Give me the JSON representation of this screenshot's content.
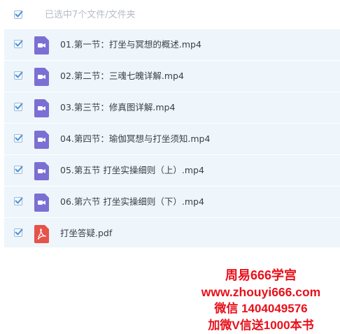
{
  "header": {
    "selection_text": "已选中7个文件/文件夹"
  },
  "files": [
    {
      "name": "01.第一节：打坐与冥想的概述.mp4",
      "type": "video-icon",
      "checked": true
    },
    {
      "name": "02.第二节：三魂七魄详解.mp4",
      "type": "video-icon",
      "checked": true
    },
    {
      "name": "03.第三节：修真图详解.mp4",
      "type": "video-icon",
      "checked": true
    },
    {
      "name": "04.第四节：瑜伽冥想与打坐须知.mp4",
      "type": "video-icon",
      "checked": true
    },
    {
      "name": "05.第五节 打坐实操细则（上）.mp4",
      "type": "video-icon",
      "checked": true
    },
    {
      "name": "06.第六节 打坐实操细则（下）.mp4",
      "type": "video-icon",
      "checked": true
    },
    {
      "name": "打坐答疑.pdf",
      "type": "pdf-icon",
      "checked": true
    }
  ],
  "watermark": {
    "line1": "周易666学宫",
    "line2": "www.zhouyi666.com",
    "line3": "微信 1404049576",
    "line4": "加微V信送1000本书"
  },
  "colors": {
    "row_background": "#eef5fb",
    "video_icon": "#7b6fd4",
    "pdf_icon": "#e5534b",
    "watermark": "#e8101a"
  }
}
